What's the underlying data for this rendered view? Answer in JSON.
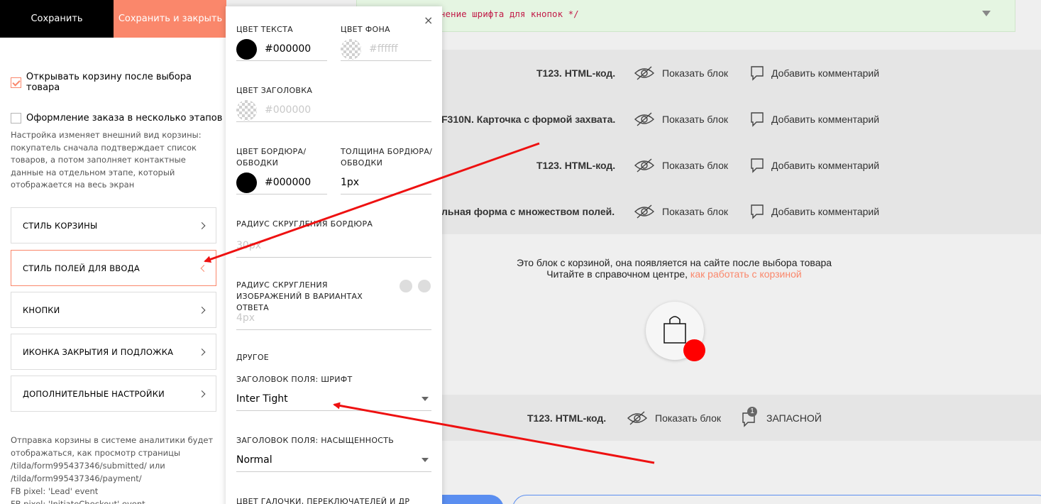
{
  "toolbar": {
    "save_label": "Сохранить",
    "save_close_label": "Сохранить и закрыть"
  },
  "settings": {
    "open_cart_label": "Открывать корзину после выбора товара",
    "open_cart_checked": true,
    "multistep_label": "Оформление заказа в несколько этапов",
    "multistep_checked": false,
    "multistep_hint": "Настройка изменяет внешний вид корзины: покупатель сначала подтверждает список товаров, а потом заполняет контактные данные на отдельном этапе, который отображается на весь экран",
    "sections": [
      {
        "label": "СТИЛЬ КОРЗИНЫ",
        "active": false
      },
      {
        "label": "СТИЛЬ ПОЛЕЙ ДЛЯ ВВОДА",
        "active": true
      },
      {
        "label": "КНОПКИ",
        "active": false
      },
      {
        "label": "ИКОНКА ЗАКРЫТИЯ И ПОДЛОЖКА",
        "active": false
      },
      {
        "label": "ДОПОЛНИТЕЛЬНЫЕ НАСТРОЙКИ",
        "active": false
      }
    ],
    "analytics_line1": "Отправка корзины в системе аналитики будет отображаться, как просмотр страницы",
    "analytics_line2": "/tilda/form995437346/submitted/ или",
    "analytics_line3": "/tilda/form995437346/payment/",
    "analytics_line4": "FB pixel: 'Lead' event",
    "analytics_line5": "FB pixel: 'InitiateCheckout' event"
  },
  "popup": {
    "close_symbol": "×",
    "text_color_label": "ЦВЕТ ТЕКСТА",
    "text_color_value": "#000000",
    "bg_color_label": "ЦВЕТ ФОНА",
    "bg_color_placeholder": "#ffffff",
    "heading_color_label": "ЦВЕТ ЗАГОЛОВКА",
    "heading_color_placeholder": "#000000",
    "border_color_label": "ЦВЕТ БОРДЮРА/ ОБВОДКИ",
    "border_color_value": "#000000",
    "border_width_label": "ТОЛЩИНА БОРДЮРА/ ОБВОДКИ",
    "border_width_value": "1px",
    "border_radius_label": "РАДИУС СКРУГЛЕНИЯ БОРДЮРА",
    "border_radius_placeholder": "30px",
    "image_radius_label": "РАДИУС СКРУГЛЕНИЯ ИЗОБРАЖЕНИЙ В ВАРИАНТАХ ОТВЕТА",
    "image_radius_placeholder": "4px",
    "other_label": "ДРУГОЕ",
    "field_font_label": "ЗАГОЛОВОК ПОЛЯ: ШРИФТ",
    "field_font_value": "Inter Tight",
    "field_weight_label": "ЗАГОЛОВОК ПОЛЯ: НАСЫЩЕННОСТЬ",
    "field_weight_value": "Normal",
    "checkbox_color_label": "ЦВЕТ ГАЛОЧКИ, ПЕРЕКЛЮЧАТЕЛЕЙ И ДР"
  },
  "editor": {
    "code_line": "нение шрифта для кнопок */",
    "blocks": [
      {
        "title": "T123. HTML-код.",
        "show_label": "Показать блок",
        "comment_label": "Добавить комментарий"
      },
      {
        "title": "F310N. Карточка с формой захвата.",
        "show_label": "Показать блок",
        "comment_label": "Добавить комментарий"
      },
      {
        "title": "T123. HTML-код.",
        "show_label": "Показать блок",
        "comment_label": "Добавить комментарий"
      },
      {
        "title": "льная форма с множеством полей.",
        "show_label": "Показать блок",
        "comment_label": "Добавить комментарий"
      }
    ],
    "cart_info_line1": "Это блок с корзиной, она появляется на сайте после выбора товара",
    "cart_info_line2": "Читайте в справочном центре, ",
    "cart_info_link": "как работать с корзиной",
    "bottom_block": {
      "title": "T123. HTML-код.",
      "show_label": "Показать блок",
      "comment_count": "1",
      "comment_label": "ЗАПАСНОЙ"
    }
  },
  "colors": {
    "accent": "#fa876b",
    "badge": "#ff0000",
    "arrow": "#ee1111"
  }
}
